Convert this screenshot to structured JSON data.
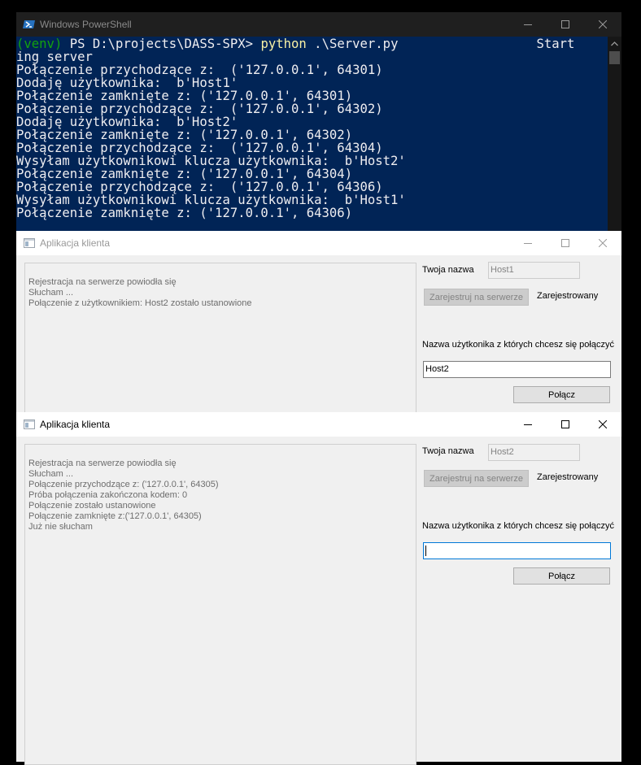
{
  "powershell": {
    "title": "Windows PowerShell",
    "prompt": {
      "venv": "(venv)",
      "path": " PS D:\\projects\\DASS-SPX> ",
      "command": "python",
      "args": " .\\Server.py",
      "wrap_tail": "Start"
    },
    "lines": [
      "ing server",
      "Połączenie przychodzące z:  ('127.0.0.1', 64301)",
      "Dodaję użytkownika:  b'Host1'",
      "Połączenie zamknięte z: ('127.0.0.1', 64301)",
      "Połączenie przychodzące z:  ('127.0.0.1', 64302)",
      "Dodaję użytkownika:  b'Host2'",
      "Połączenie zamknięte z: ('127.0.0.1', 64302)",
      "Połączenie przychodzące z:  ('127.0.0.1', 64304)",
      "Wysyłam użytkownikowi klucza użytkownika:  b'Host2'",
      "Połączenie zamknięte z: ('127.0.0.1', 64304)",
      "Połączenie przychodzące z:  ('127.0.0.1', 64306)",
      "Wysyłam użytkownikowi klucza użytkownika:  b'Host1'",
      "Połączenie zamknięte z: ('127.0.0.1', 64306)"
    ]
  },
  "client1": {
    "title": "Aplikacja klienta",
    "log": [
      "Rejestracja na serwerze powiodła się",
      "Słucham ...",
      "Połączenie z użytkownikiem: Host2 zostało ustanowione"
    ],
    "name_label": "Twoja nazwa",
    "name_value": "Host1",
    "register_button": "Zarejestruj na serwerze",
    "status": "Zarejestrowany",
    "peer_label": "Nazwa użytkonika z których chcesz się połączyć",
    "peer_value": "Host2",
    "connect_button": "Połącz"
  },
  "client2": {
    "title": "Aplikacja klienta",
    "log": [
      "Rejestracja na serwerze powiodła się",
      "Słucham ...",
      "Połączenie przychodzące z: ('127.0.0.1', 64305)",
      "Próba połączenia zakończona kodem: 0",
      "Połączenie zostało ustanowione",
      "Połączenie zamknięte z:('127.0.0.1', 64305)",
      "Już nie słucham"
    ],
    "name_label": "Twoja nazwa",
    "name_value": "Host2",
    "register_button": "Zarejestruj na serwerze",
    "status": "Zarejestrowany",
    "peer_label": "Nazwa użytkonika z których chcesz się połączyć",
    "peer_value": "",
    "connect_button": "Połącz"
  },
  "icons": [
    "powershell-icon",
    "app-window-icon",
    "minimize-icon",
    "maximize-icon",
    "close-icon",
    "scroll-up-arrow-icon"
  ],
  "colors": {
    "ps_background": "#012456",
    "ps_green": "#13a10e",
    "ps_yellow": "#f9f1a5",
    "focus_border": "#0078d7"
  }
}
